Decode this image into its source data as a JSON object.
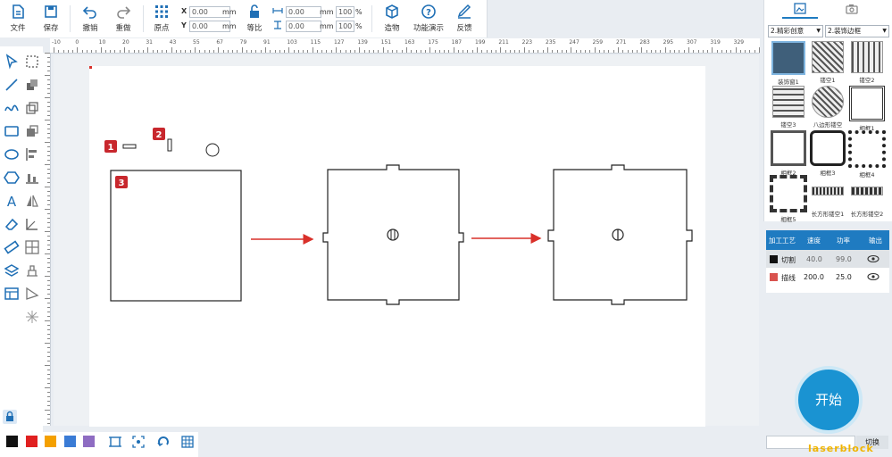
{
  "toolbar": {
    "file": "文件",
    "save": "保存",
    "undo": "撤销",
    "redo": "重做",
    "origin": "原点",
    "x_label": "X",
    "x_value": "0.00",
    "x_unit": "mm",
    "y_label": "Y",
    "y_value": "0.00",
    "y_unit": "mm",
    "ratio": "等比",
    "w_value": "0.00",
    "w_unit": "mm",
    "w_pct": "100",
    "w_pct_unit": "%",
    "h_value": "0.00",
    "h_unit": "mm",
    "h_pct": "100",
    "h_pct_unit": "%",
    "build": "造物",
    "demo": "功能演示",
    "feedback": "反馈"
  },
  "ruler": {
    "top_ticks": [
      "-10",
      "0",
      "10",
      "20",
      "31",
      "43",
      "55",
      "67",
      "79",
      "91",
      "103",
      "115",
      "127",
      "139",
      "151",
      "163",
      "175",
      "187",
      "199",
      "211",
      "223",
      "235",
      "247",
      "259",
      "271",
      "283",
      "295",
      "307",
      "319",
      "329"
    ]
  },
  "canvas": {
    "callouts": [
      "1",
      "2",
      "3"
    ]
  },
  "colors": [
    "#111111",
    "#e02020",
    "#f4a000",
    "#3a7bd5",
    "#8e6cc2"
  ],
  "right_panel": {
    "dropdown1": "2.精彩创意",
    "dropdown2": "2.装饰边框",
    "library": [
      {
        "label": "装饰窗1"
      },
      {
        "label": "镂空1"
      },
      {
        "label": "镂空2"
      },
      {
        "label": "镂空3"
      },
      {
        "label": "八边形镂空"
      },
      {
        "label": "相框1"
      },
      {
        "label": "相框2"
      },
      {
        "label": "相框3"
      },
      {
        "label": "相框4"
      },
      {
        "label": "相框5"
      },
      {
        "label": "长方形镂空1"
      },
      {
        "label": "长方形镂空2"
      }
    ]
  },
  "layers": {
    "headers": [
      "加工工艺",
      "速度",
      "功率",
      "输出"
    ],
    "rows": [
      {
        "color": "#111111",
        "name": "切割",
        "speed": "40.0",
        "power": "99.0"
      },
      {
        "color": "#d9534f",
        "name": "描线",
        "speed": "200.0",
        "power": "25.0"
      }
    ]
  },
  "start_button": "开始",
  "switch_label": "切换",
  "watermark": "laserblock"
}
